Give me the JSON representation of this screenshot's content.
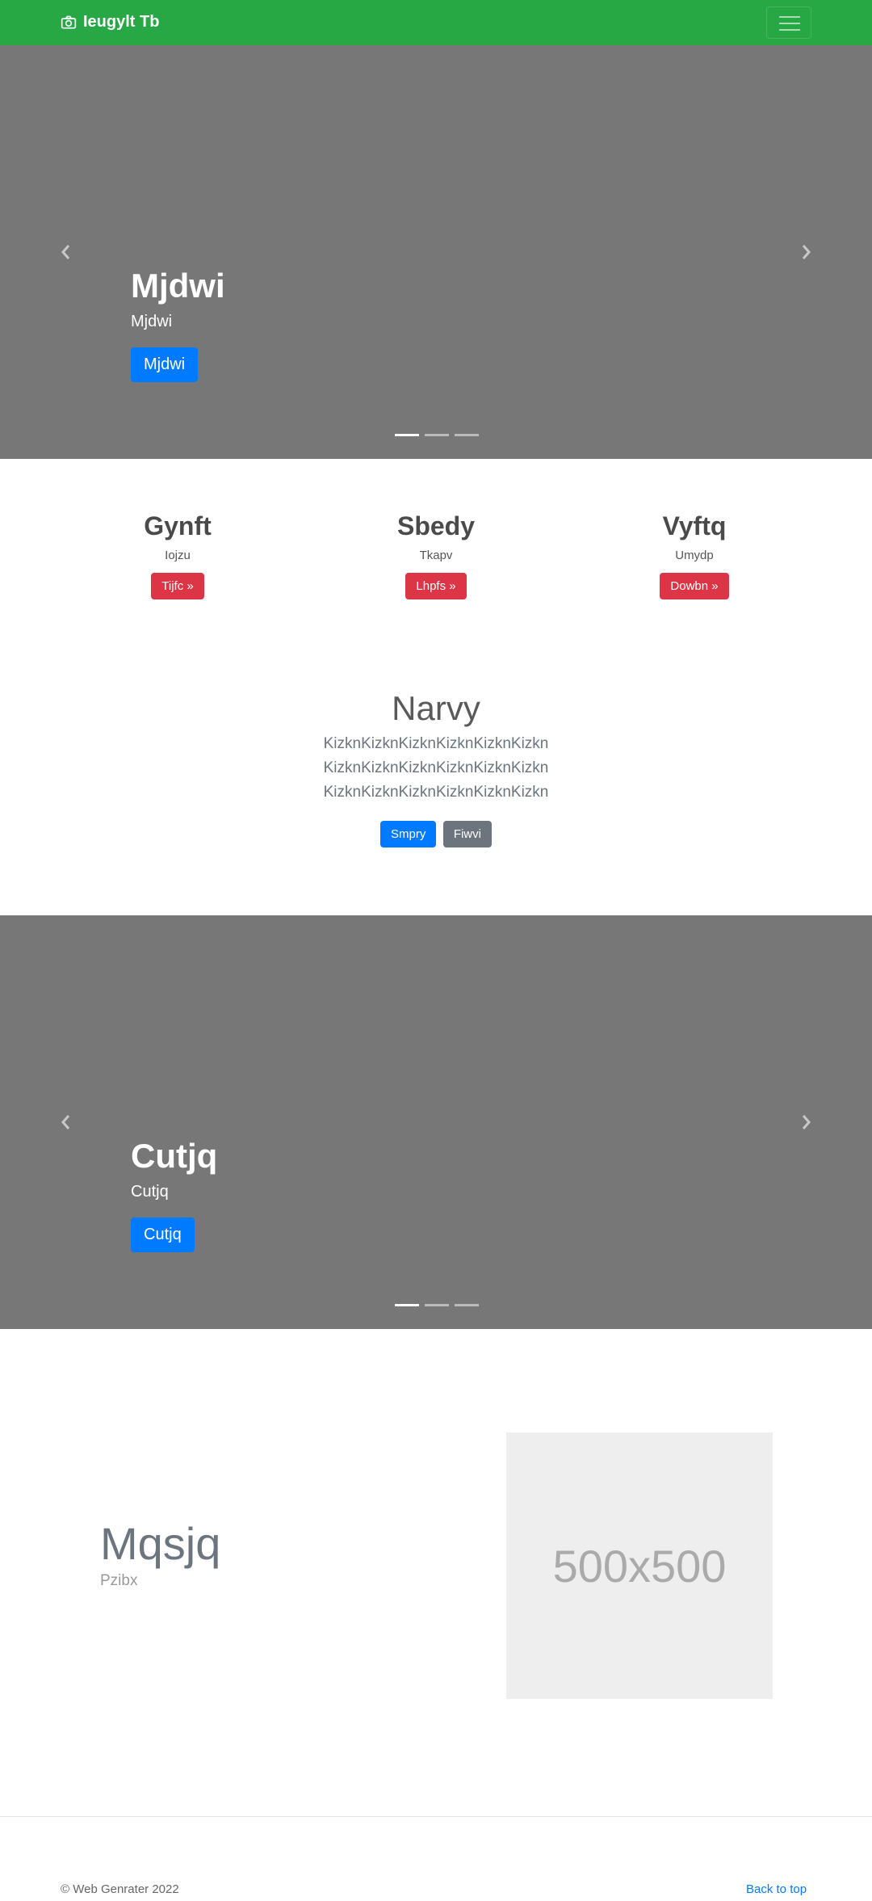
{
  "navbar": {
    "brand": "Ieugylt Tb",
    "brand_color": "#28a745"
  },
  "carousel1": {
    "title": "Mjdwi",
    "text": "Mjdwi",
    "button": "Mjdwi"
  },
  "features": [
    {
      "title": "Gynft",
      "text": "Iojzu",
      "button": "Tijfc »"
    },
    {
      "title": "Sbedy",
      "text": "Tkapv",
      "button": "Lhpfs »"
    },
    {
      "title": "Vyftq",
      "text": "Umydp",
      "button": "Dowbn »"
    }
  ],
  "jumbotron": {
    "title": "Narvy",
    "lead": "KizknKizknKizknKizknKizknKizkn KizknKizknKizknKizknKizknKizkn KizknKizknKizknKizknKizknKizkn",
    "primary_button": "Smpry",
    "secondary_button": "Fiwvi"
  },
  "carousel2": {
    "title": "Cutjq",
    "text": "Cutjq",
    "button": "Cutjq"
  },
  "featurette": {
    "title": "Mqsjq",
    "text": "Pzibx",
    "image_label": "500x500"
  },
  "footer": {
    "copyright": "© Web Genrater 2022",
    "back_to_top": "Back to top"
  }
}
